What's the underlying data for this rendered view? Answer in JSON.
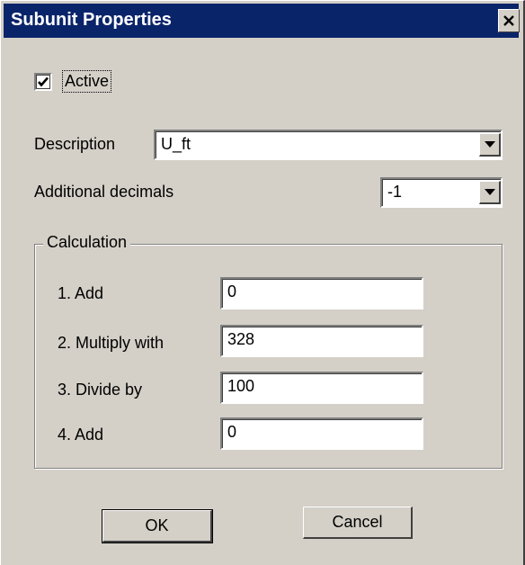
{
  "window": {
    "title": "Subunit Properties"
  },
  "active": {
    "label": "Active",
    "checked": true
  },
  "description": {
    "label": "Description",
    "value": "U_ft"
  },
  "additional_decimals": {
    "label": "Additional decimals",
    "value": "-1"
  },
  "calculation": {
    "title": "Calculation",
    "rows": [
      {
        "label": "1. Add",
        "value": "0"
      },
      {
        "label": "2. Multiply with",
        "value": "328"
      },
      {
        "label": "3. Divide by",
        "value": "100"
      },
      {
        "label": "4. Add",
        "value": "0"
      }
    ]
  },
  "buttons": {
    "ok": "OK",
    "cancel": "Cancel"
  },
  "colors": {
    "titlebar": "#0a246a",
    "face": "#d4d0c8"
  },
  "icons": {
    "close": "close-icon",
    "dropdown": "chevron-down-icon",
    "check": "check-icon"
  }
}
